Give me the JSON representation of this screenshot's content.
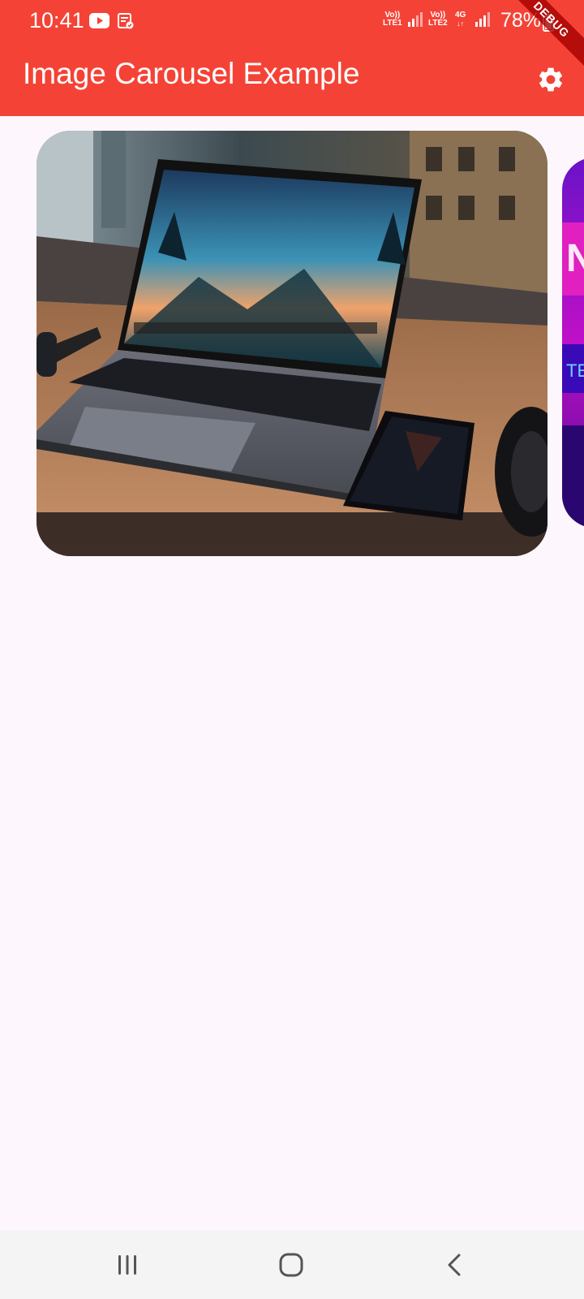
{
  "status_bar": {
    "time": "10:41",
    "sim1_label_top": "Vo))",
    "sim1_label_bottom": "LTE1",
    "sim2_label_top": "Vo))",
    "sim2_label_bottom": "LTE2",
    "network_type": "4G",
    "battery": "78%"
  },
  "app_bar": {
    "title": "Image Carousel Example",
    "action_icon": "gear-icon"
  },
  "debug_banner": "DEBUG",
  "carousel": {
    "current_index": 0,
    "slides": [
      {
        "description_icon": "laptop-photo"
      },
      {
        "description_icon": "purple-poster"
      }
    ]
  },
  "nav_bar": {
    "buttons": [
      "recents-icon",
      "home-icon",
      "back-icon"
    ]
  },
  "colors": {
    "app_bar": "#f44336",
    "background": "#fdf7fd",
    "nav_bar": "#f4f4f4"
  }
}
